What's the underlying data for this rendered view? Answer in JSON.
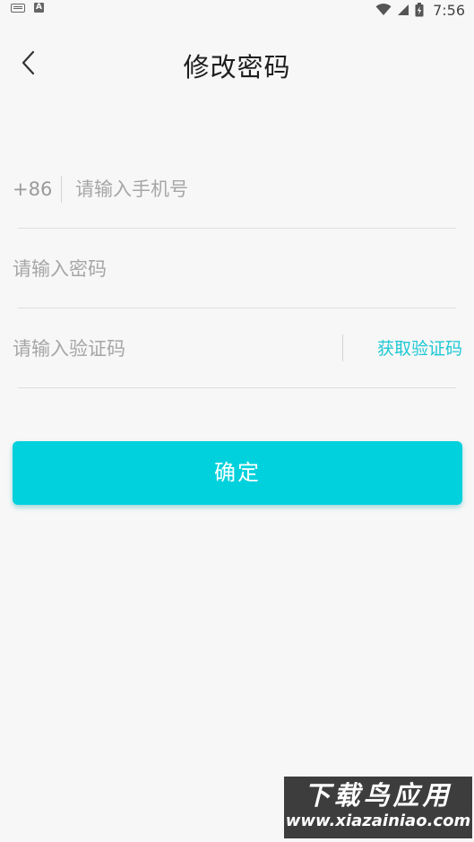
{
  "status_bar": {
    "keyboard_icon": "keyboard-icon",
    "notification_icon": "a-notification-icon",
    "wifi_icon": "wifi-icon",
    "signal_icon": "signal-icon",
    "battery_icon": "battery-charging-icon",
    "time": "7:56"
  },
  "header": {
    "back_icon": "chevron-left-icon",
    "title": "修改密码"
  },
  "form": {
    "country_code": "+86",
    "phone_placeholder": "请输入手机号",
    "phone_value": "",
    "password_placeholder": "请输入密码",
    "password_value": "",
    "code_placeholder": "请输入验证码",
    "code_value": "",
    "get_code_label": "获取验证码"
  },
  "confirm_label": "确定",
  "watermark": {
    "line1": "下载鸟应用",
    "line2": "www.xiazainiao.com"
  },
  "colors": {
    "accent": "#00d1dc",
    "link": "#1ec8d4",
    "background": "#f7f7f7"
  }
}
